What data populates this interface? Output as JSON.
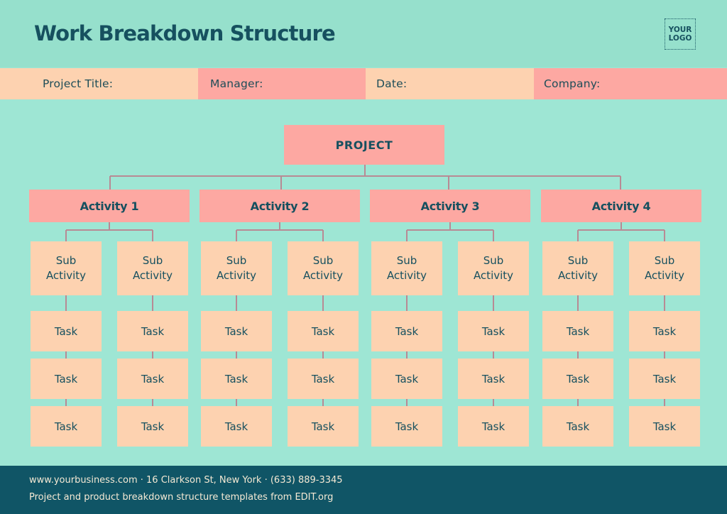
{
  "header": {
    "title": "Work Breakdown Structure",
    "logo_line1": "YOUR",
    "logo_line2": "LOGO"
  },
  "info_bar": {
    "fields": [
      {
        "label": "Project Title:",
        "value": ""
      },
      {
        "label": "Manager:",
        "value": ""
      },
      {
        "label": "Date:",
        "value": ""
      },
      {
        "label": "Company:",
        "value": ""
      }
    ]
  },
  "tree": {
    "root": "PROJECT",
    "activities": [
      {
        "label": "Activity 1",
        "sub_activities": [
          {
            "label": "Sub Activity",
            "tasks": [
              "Task",
              "Task",
              "Task"
            ]
          },
          {
            "label": "Sub Activity",
            "tasks": [
              "Task",
              "Task",
              "Task"
            ]
          }
        ]
      },
      {
        "label": "Activity 2",
        "sub_activities": [
          {
            "label": "Sub Activity",
            "tasks": [
              "Task",
              "Task",
              "Task"
            ]
          },
          {
            "label": "Sub Activity",
            "tasks": [
              "Task",
              "Task",
              "Task"
            ]
          }
        ]
      },
      {
        "label": "Activity 3",
        "sub_activities": [
          {
            "label": "Sub Activity",
            "tasks": [
              "Task",
              "Task",
              "Task"
            ]
          },
          {
            "label": "Sub Activity",
            "tasks": [
              "Task",
              "Task",
              "Task"
            ]
          }
        ]
      },
      {
        "label": "Activity 4",
        "sub_activities": [
          {
            "label": "Sub Activity",
            "tasks": [
              "Task",
              "Task",
              "Task"
            ]
          },
          {
            "label": "Sub Activity",
            "tasks": [
              "Task",
              "Task",
              "Task"
            ]
          }
        ]
      }
    ]
  },
  "colors": {
    "background": "#9ee6d4",
    "dark_teal": "#16505f",
    "pink": "#fda8a2",
    "peach": "#fdd2b0",
    "connector": "#b88a94",
    "footer_bg": "#105566"
  },
  "footer": {
    "line1": "www.yourbusiness.com · 16 Clarkson St, New York · (633) 889-3345",
    "line2": "Project and product breakdown structure templates from EDIT.org"
  }
}
